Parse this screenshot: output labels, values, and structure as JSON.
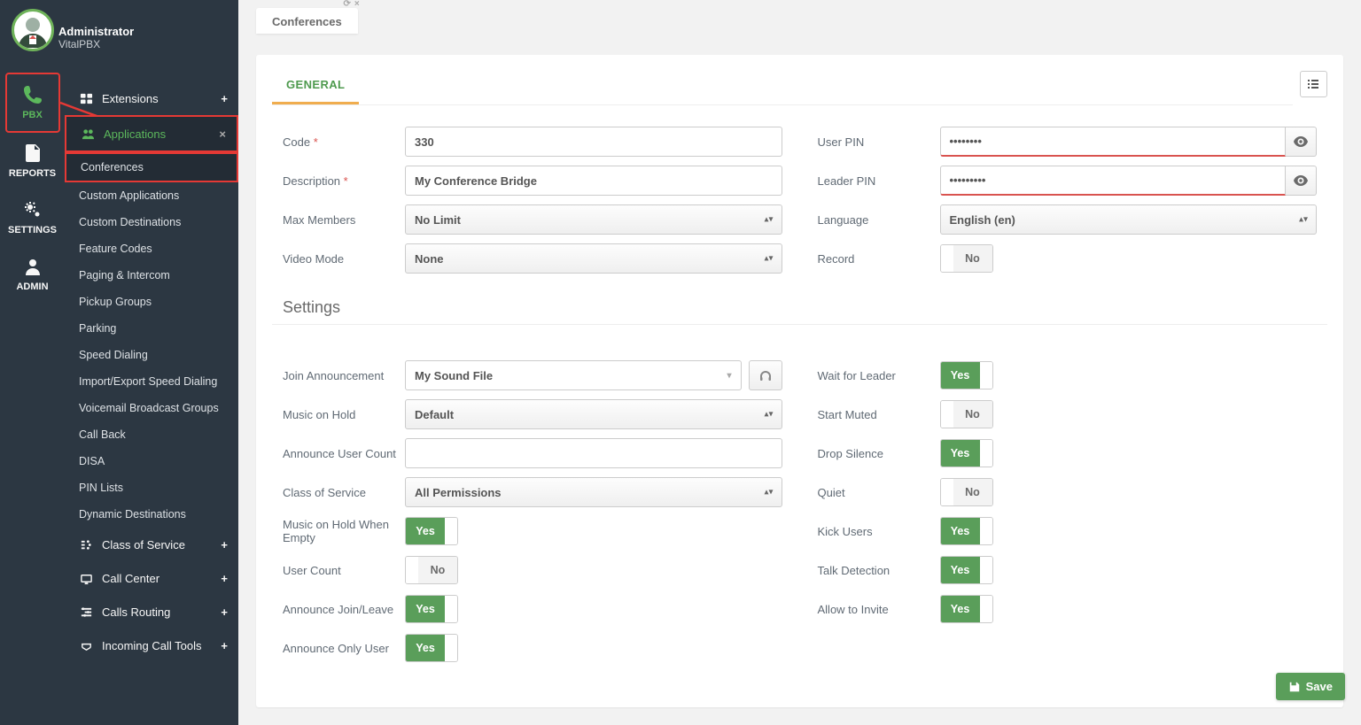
{
  "user": {
    "name": "Administrator",
    "org": "VitalPBX"
  },
  "mainnav": {
    "pbx": "PBX",
    "reports": "REPORTS",
    "settings": "SETTINGS",
    "admin": "ADMIN"
  },
  "submenu": {
    "extensions": "Extensions",
    "applications": "Applications",
    "children": [
      "Conferences",
      "Custom Applications",
      "Custom Destinations",
      "Feature Codes",
      "Paging & Intercom",
      "Pickup Groups",
      "Parking",
      "Speed Dialing",
      "Import/Export Speed Dialing",
      "Voicemail Broadcast Groups",
      "Call Back",
      "DISA",
      "PIN Lists",
      "Dynamic Destinations"
    ],
    "cos": "Class of Service",
    "cc": "Call Center",
    "cr": "Calls Routing",
    "ict": "Incoming Call Tools"
  },
  "page": {
    "tab_title": "Conferences",
    "main_tab": "GENERAL"
  },
  "form": {
    "code_label": "Code",
    "code_value": "330",
    "desc_label": "Description",
    "desc_value": "My Conference Bridge",
    "maxm_label": "Max Members",
    "maxm_value": "No Limit",
    "video_label": "Video Mode",
    "video_value": "None",
    "upin_label": "User PIN",
    "upin_value": "••••••••",
    "lpin_label": "Leader PIN",
    "lpin_value": "•••••••••",
    "lang_label": "Language",
    "lang_value": "English (en)",
    "rec_label": "Record",
    "rec_value": "No"
  },
  "settings_title": "Settings",
  "settings_left": {
    "join_label": "Join Announcement",
    "join_value": "My Sound File",
    "moh_label": "Music on Hold",
    "moh_value": "Default",
    "auc_label": "Announce User Count",
    "cos_label": "Class of Service",
    "cos_value": "All Permissions",
    "mohe_label": "Music on Hold When Empty",
    "mohe_value": "Yes",
    "uc_label": "User Count",
    "uc_value": "No",
    "ajl_label": "Announce Join/Leave",
    "ajl_value": "Yes",
    "aou_label": "Announce Only User",
    "aou_value": "Yes"
  },
  "settings_right": {
    "wfl_label": "Wait for Leader",
    "wfl_value": "Yes",
    "sm_label": "Start Muted",
    "sm_value": "No",
    "ds_label": "Drop Silence",
    "ds_value": "Yes",
    "q_label": "Quiet",
    "q_value": "No",
    "ku_label": "Kick Users",
    "ku_value": "Yes",
    "td_label": "Talk Detection",
    "td_value": "Yes",
    "ati_label": "Allow to Invite",
    "ati_value": "Yes"
  },
  "buttons": {
    "save": "Save"
  },
  "yesno": {
    "yes": "Yes",
    "no": "No"
  }
}
